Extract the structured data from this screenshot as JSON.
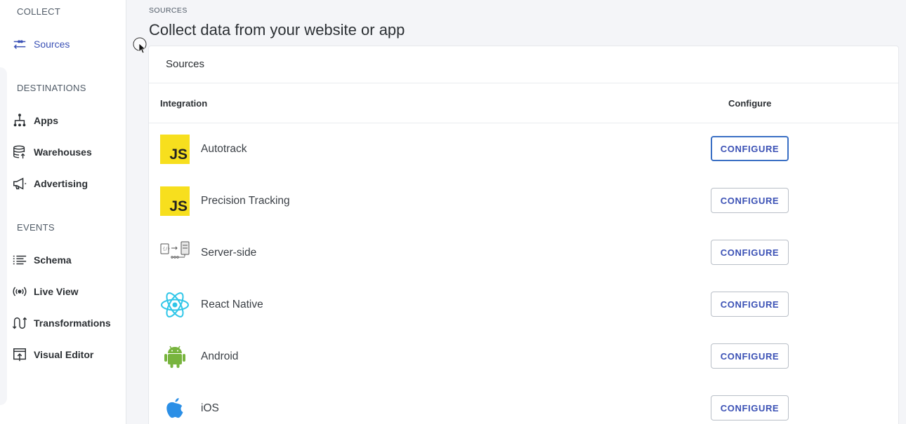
{
  "sidebar": {
    "sections": [
      {
        "label": "COLLECT"
      },
      {
        "label": "DESTINATIONS"
      },
      {
        "label": "EVENTS"
      }
    ],
    "items": [
      {
        "label": "Sources",
        "icon": "sources-icon",
        "active": true
      },
      {
        "label": "Apps",
        "icon": "apps-icon"
      },
      {
        "label": "Warehouses",
        "icon": "database-icon"
      },
      {
        "label": "Advertising",
        "icon": "megaphone-icon"
      },
      {
        "label": "Schema",
        "icon": "list-icon"
      },
      {
        "label": "Live View",
        "icon": "broadcast-icon"
      },
      {
        "label": "Transformations",
        "icon": "transform-icon"
      },
      {
        "label": "Visual Editor",
        "icon": "visual-editor-icon"
      }
    ]
  },
  "header": {
    "breadcrumb": "SOURCES",
    "title": "Collect data from your website or app"
  },
  "card": {
    "title": "Sources",
    "columns": [
      "Integration",
      "Configure"
    ],
    "rows": [
      {
        "name": "Autotrack",
        "logo": "javascript-logo",
        "logo_text": "JS",
        "button": "CONFIGURE"
      },
      {
        "name": "Precision Tracking",
        "logo": "javascript-logo",
        "logo_text": "JS",
        "button": "CONFIGURE"
      },
      {
        "name": "Server-side",
        "logo": "server-logo",
        "button": "CONFIGURE"
      },
      {
        "name": "React Native",
        "logo": "react-logo",
        "button": "CONFIGURE"
      },
      {
        "name": "Android",
        "logo": "android-logo",
        "button": "CONFIGURE"
      },
      {
        "name": "iOS",
        "logo": "apple-logo",
        "button": "CONFIGURE"
      }
    ]
  },
  "colors": {
    "accent": "#3b51b5",
    "js_yellow": "#f7df1e",
    "react_cyan": "#2fc6e8",
    "android_green": "#78b43e",
    "ios_blue": "#2b8fe6"
  }
}
